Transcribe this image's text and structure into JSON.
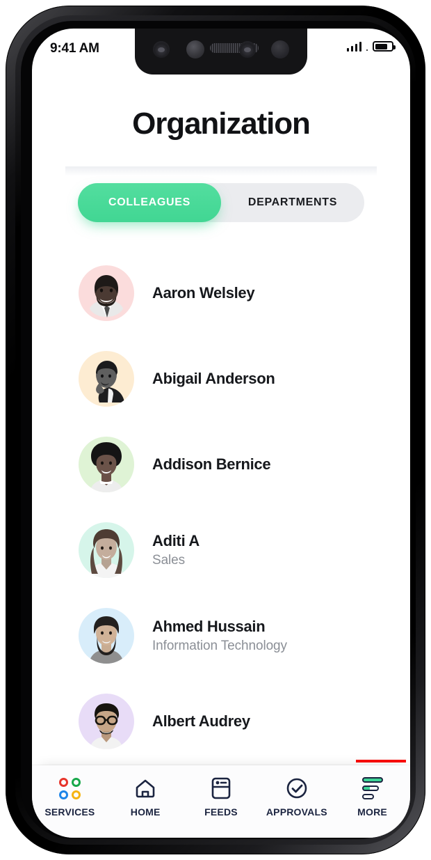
{
  "status_bar": {
    "time": "9:41 AM",
    "signal_icon": "signal-bars-icon",
    "battery_icon": "battery-icon",
    "battery_level_percent": 65
  },
  "header": {
    "title": "Organization"
  },
  "segmented_control": {
    "active_index": 0,
    "active_color": "#41d693",
    "inactive_bg": "#ebecef",
    "tabs": [
      {
        "label": "COLLEAGUES",
        "active": true
      },
      {
        "label": "DEPARTMENTS",
        "active": false
      }
    ]
  },
  "colleagues": [
    {
      "name": "Aaron Welsley",
      "department": "",
      "avatar_bg": "#fbdcdc",
      "avatar_name": "avatar-aaron-welsley"
    },
    {
      "name": "Abigail Anderson",
      "department": "",
      "avatar_bg": "#fdecd2",
      "avatar_name": "avatar-abigail-anderson"
    },
    {
      "name": "Addison Bernice",
      "department": "",
      "avatar_bg": "#dff3d5",
      "avatar_name": "avatar-addison-bernice"
    },
    {
      "name": "Aditi A",
      "department": "Sales",
      "avatar_bg": "#d6f5ea",
      "avatar_name": "avatar-aditi-a"
    },
    {
      "name": "Ahmed Hussain",
      "department": "Information Technology",
      "avatar_bg": "#d8edfa",
      "avatar_name": "avatar-ahmed-hussain"
    },
    {
      "name": "Albert Audrey",
      "department": "",
      "avatar_bg": "#e8dcf7",
      "avatar_name": "avatar-albert-audrey"
    }
  ],
  "scroll_indicator": {
    "color": "#fb0d08"
  },
  "tab_bar": {
    "label_color": "#1b2440",
    "items": [
      {
        "label": "SERVICES",
        "icon": "services-grid-icon"
      },
      {
        "label": "HOME",
        "icon": "home-icon"
      },
      {
        "label": "FEEDS",
        "icon": "feeds-card-icon"
      },
      {
        "label": "APPROVALS",
        "icon": "check-circle-icon"
      },
      {
        "label": "MORE",
        "icon": "more-lines-icon"
      }
    ],
    "services_dot_colors": [
      "#e7342a",
      "#18a84a",
      "#1d85e8",
      "#f6b411"
    ]
  }
}
